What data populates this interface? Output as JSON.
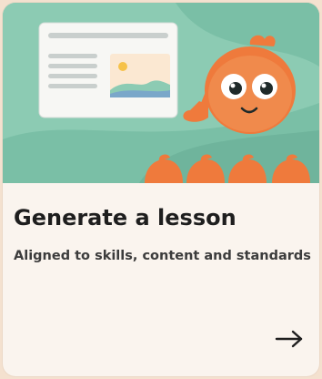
{
  "card": {
    "title": "Generate a lesson",
    "subtitle": "Aligned to skills, content and standards",
    "action_icon": "arrow-right-icon"
  },
  "colors": {
    "illustration_bg": "#8ccbb3",
    "illustration_band": "#6fb49c",
    "mascot": "#ef7a3c",
    "card_bg": "#faf4ee",
    "page_bg": "#f4e1cf"
  }
}
